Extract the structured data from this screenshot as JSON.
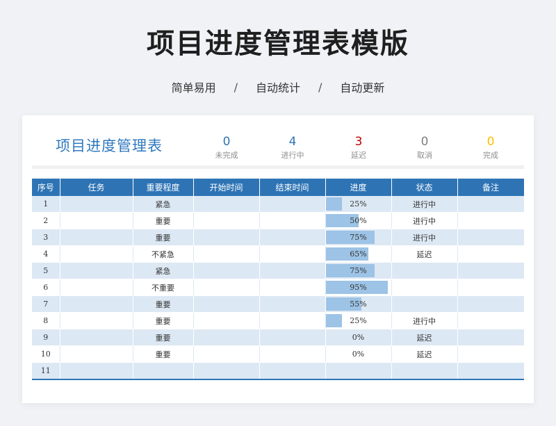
{
  "header": {
    "title": "项目进度管理表模版",
    "tags": [
      "简单易用",
      "自动统计",
      "自动更新"
    ],
    "separator": "/"
  },
  "sheet": {
    "title": "项目进度管理表",
    "stats": [
      {
        "value": "0",
        "label": "未完成",
        "color": "#2e74b5"
      },
      {
        "value": "4",
        "label": "进行中",
        "color": "#2e74b5"
      },
      {
        "value": "3",
        "label": "延迟",
        "color": "#c00000"
      },
      {
        "value": "0",
        "label": "取消",
        "color": "#7f7f7f"
      },
      {
        "value": "0",
        "label": "完成",
        "color": "#ffc000"
      }
    ]
  },
  "table": {
    "columns": [
      "序号",
      "任务",
      "重要程度",
      "开始时间",
      "结束时间",
      "进度",
      "状态",
      "备注"
    ],
    "rows": [
      {
        "no": "1",
        "task": "",
        "priority": "紧急",
        "start": "",
        "end": "",
        "progress": "25%",
        "progress_value": 25,
        "status": "进行中",
        "note": ""
      },
      {
        "no": "2",
        "task": "",
        "priority": "重要",
        "start": "",
        "end": "",
        "progress": "50%",
        "progress_value": 50,
        "status": "进行中",
        "note": ""
      },
      {
        "no": "3",
        "task": "",
        "priority": "重要",
        "start": "",
        "end": "",
        "progress": "75%",
        "progress_value": 75,
        "status": "进行中",
        "note": ""
      },
      {
        "no": "4",
        "task": "",
        "priority": "不紧急",
        "start": "",
        "end": "",
        "progress": "65%",
        "progress_value": 65,
        "status": "延迟",
        "note": ""
      },
      {
        "no": "5",
        "task": "",
        "priority": "紧急",
        "start": "",
        "end": "",
        "progress": "75%",
        "progress_value": 75,
        "status": "",
        "note": ""
      },
      {
        "no": "6",
        "task": "",
        "priority": "不重要",
        "start": "",
        "end": "",
        "progress": "95%",
        "progress_value": 95,
        "status": "",
        "note": ""
      },
      {
        "no": "7",
        "task": "",
        "priority": "重要",
        "start": "",
        "end": "",
        "progress": "55%",
        "progress_value": 55,
        "status": "",
        "note": ""
      },
      {
        "no": "8",
        "task": "",
        "priority": "重要",
        "start": "",
        "end": "",
        "progress": "25%",
        "progress_value": 25,
        "status": "进行中",
        "note": ""
      },
      {
        "no": "9",
        "task": "",
        "priority": "重要",
        "start": "",
        "end": "",
        "progress": "0%",
        "progress_value": 0,
        "status": "延迟",
        "note": ""
      },
      {
        "no": "10",
        "task": "",
        "priority": "重要",
        "start": "",
        "end": "",
        "progress": "0%",
        "progress_value": 0,
        "status": "延迟",
        "note": ""
      },
      {
        "no": "11",
        "task": "",
        "priority": "",
        "start": "",
        "end": "",
        "progress": "",
        "progress_value": 0,
        "status": "",
        "note": ""
      }
    ]
  }
}
